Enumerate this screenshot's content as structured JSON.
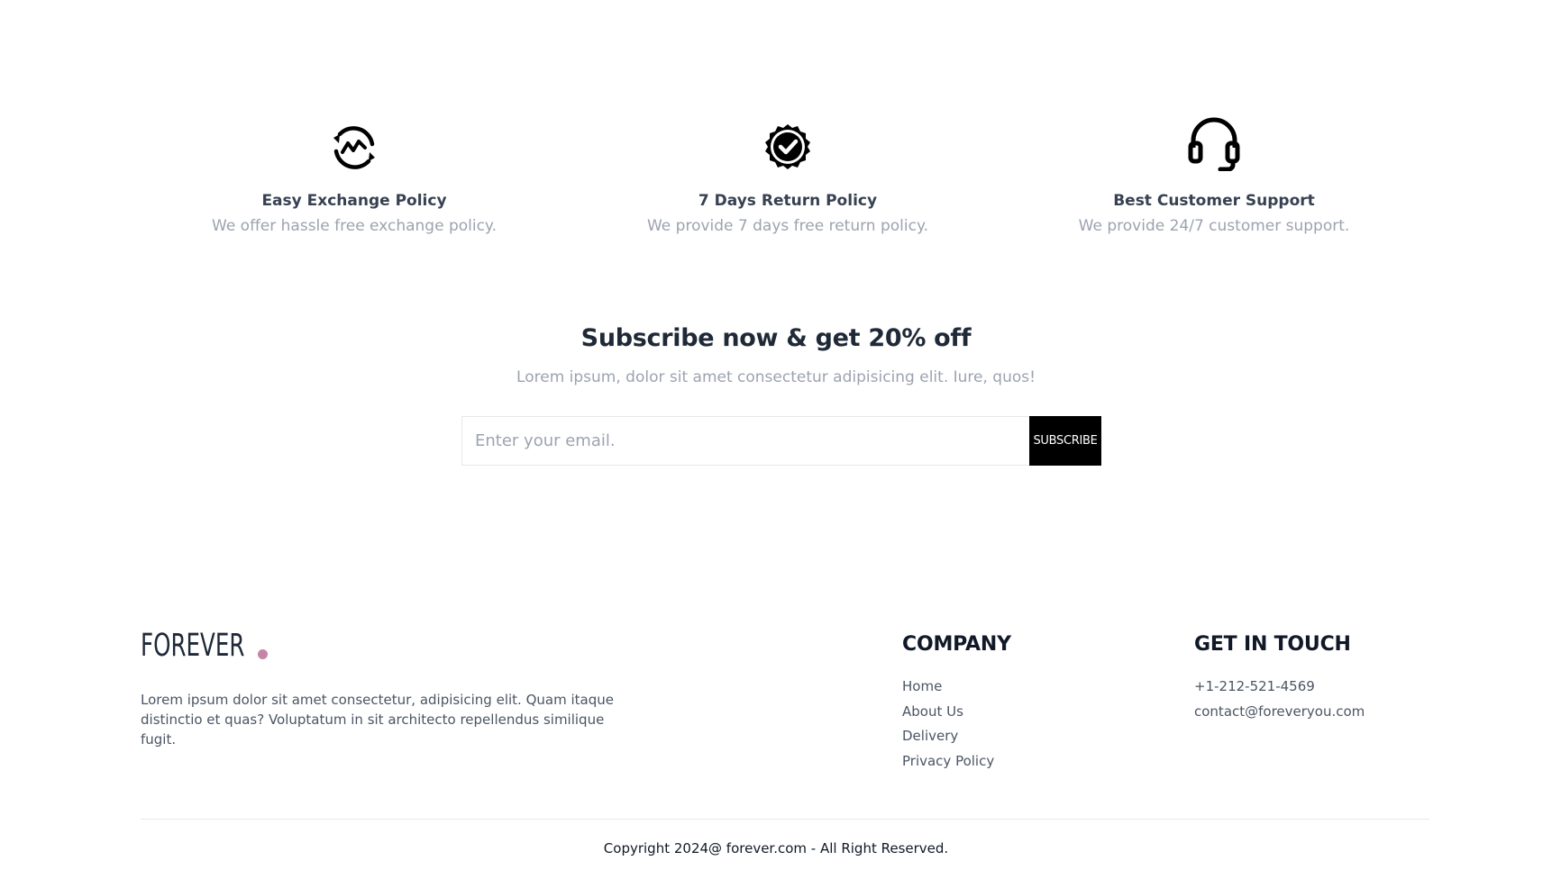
{
  "policies": [
    {
      "icon": "exchange-icon",
      "title": "Easy Exchange Policy",
      "description": "We offer hassle free exchange policy."
    },
    {
      "icon": "quality-badge-icon",
      "title": "7 Days Return Policy",
      "description": "We provide 7 days free return policy."
    },
    {
      "icon": "headset-icon",
      "title": "Best Customer Support",
      "description": "We provide 24/7 customer support."
    }
  ],
  "subscribe": {
    "heading": "Subscribe now & get 20% off",
    "subheading": "Lorem ipsum, dolor sit amet consectetur adipisicing elit. Iure, quos!",
    "email_placeholder": "Enter your email.",
    "email_value": "",
    "button_label": "SUBSCRIBE"
  },
  "footer": {
    "logo": {
      "text": "FOREVER",
      "dot_color": "#c586a5"
    },
    "about": "Lorem ipsum dolor sit amet consectetur, adipisicing elit. Quam itaque distinctio et quas? Voluptatum in sit architecto repellendus similique fugit.",
    "company": {
      "title": "COMPANY",
      "links": [
        "Home",
        "About Us",
        "Delivery",
        "Privacy Policy"
      ]
    },
    "contact": {
      "title": "GET IN TOUCH",
      "phone": "+1-212-521-4569",
      "email": "contact@foreveryou.com"
    },
    "copyright": "Copyright 2024@ forever.com - All Right Reserved."
  },
  "colors": {
    "accent_dot": "#c586a5",
    "button_bg": "#000000",
    "muted_text": "#9ca3af"
  }
}
